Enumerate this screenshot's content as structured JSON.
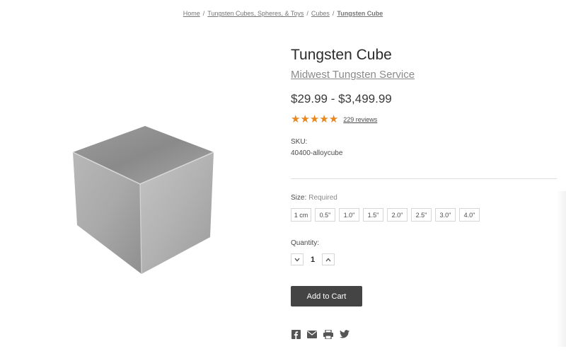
{
  "breadcrumb": {
    "items": [
      {
        "label": "Home"
      },
      {
        "label": "Tungsten Cubes, Spheres, & Toys"
      },
      {
        "label": "Cubes"
      }
    ],
    "separator": "/",
    "current": "Tungsten Cube"
  },
  "product": {
    "title": "Tungsten Cube",
    "brand": "Midwest Tungsten Service",
    "price": "$29.99 - $3,499.99",
    "rating": 5,
    "star_color": "#e8871e",
    "reviews_label": "229 reviews",
    "sku_label": "SKU:",
    "sku_value": "40400-alloycube",
    "image_icon": "tungsten-cube-image"
  },
  "size": {
    "label": "Size:",
    "required": "Required",
    "options": [
      {
        "label": "1 cm"
      },
      {
        "label": "0.5\""
      },
      {
        "label": "1.0\""
      },
      {
        "label": "1.5\""
      },
      {
        "label": "2.0\""
      },
      {
        "label": "2.5\""
      },
      {
        "label": "3.0\""
      },
      {
        "label": "4.0\""
      }
    ]
  },
  "quantity": {
    "label": "Quantity:",
    "value": "1",
    "decrement_icon": "chevron-down-icon",
    "increment_icon": "chevron-up-icon"
  },
  "cart": {
    "button_label": "Add to Cart",
    "button_color": "#444444"
  },
  "share": {
    "icons": [
      "facebook-icon",
      "email-icon",
      "print-icon",
      "twitter-icon"
    ]
  }
}
